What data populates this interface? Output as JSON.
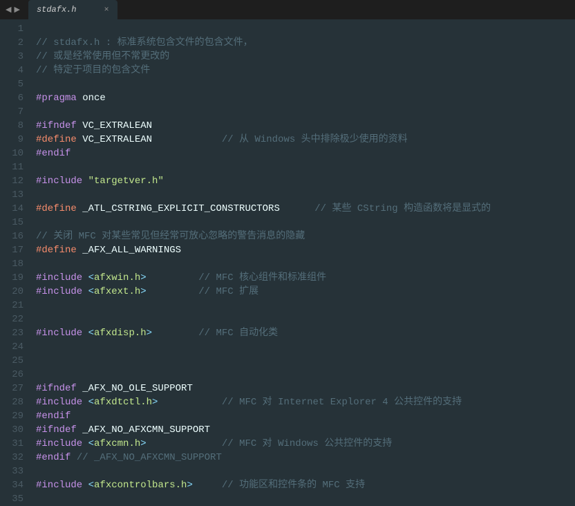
{
  "tab": {
    "title": "stdafx.h",
    "close": "×"
  },
  "nav": {
    "left": "◀",
    "right": "▶"
  },
  "code_lines": [
    {
      "n": 1,
      "tokens": []
    },
    {
      "n": 2,
      "tokens": [
        {
          "cls": "c-comment",
          "t": "// stdafx.h : 标准系统包含文件的包含文件，"
        }
      ]
    },
    {
      "n": 3,
      "tokens": [
        {
          "cls": "c-comment",
          "t": "// 或是经常使用但不常更改的"
        }
      ]
    },
    {
      "n": 4,
      "tokens": [
        {
          "cls": "c-comment",
          "t": "// 特定于项目的包含文件"
        }
      ]
    },
    {
      "n": 5,
      "tokens": []
    },
    {
      "n": 6,
      "tokens": [
        {
          "cls": "c-preproc",
          "t": "#pragma"
        },
        {
          "cls": "c-plain",
          "t": " once"
        }
      ]
    },
    {
      "n": 7,
      "tokens": []
    },
    {
      "n": 8,
      "tokens": [
        {
          "cls": "c-preproc",
          "t": "#ifndef"
        },
        {
          "cls": "c-plain",
          "t": " VC_EXTRALEAN"
        }
      ]
    },
    {
      "n": 9,
      "tokens": [
        {
          "cls": "c-define",
          "t": "#define"
        },
        {
          "cls": "c-plain",
          "t": " VC_EXTRALEAN            "
        },
        {
          "cls": "c-comment",
          "t": "// 从 Windows 头中排除极少使用的资料"
        }
      ]
    },
    {
      "n": 10,
      "tokens": [
        {
          "cls": "c-preproc",
          "t": "#endif"
        }
      ]
    },
    {
      "n": 11,
      "tokens": []
    },
    {
      "n": 12,
      "tokens": [
        {
          "cls": "c-preproc",
          "t": "#include "
        },
        {
          "cls": "c-string",
          "t": "\"targetver.h\""
        }
      ]
    },
    {
      "n": 13,
      "tokens": []
    },
    {
      "n": 14,
      "tokens": [
        {
          "cls": "c-define",
          "t": "#define"
        },
        {
          "cls": "c-plain",
          "t": " _ATL_CSTRING_EXPLICIT_CONSTRUCTORS      "
        },
        {
          "cls": "c-comment",
          "t": "// 某些 CString 构造函数将是显式的"
        }
      ]
    },
    {
      "n": 15,
      "tokens": []
    },
    {
      "n": 16,
      "tokens": [
        {
          "cls": "c-comment",
          "t": "// 关闭 MFC 对某些常见但经常可放心忽略的警告消息的隐藏"
        }
      ]
    },
    {
      "n": 17,
      "tokens": [
        {
          "cls": "c-define",
          "t": "#define"
        },
        {
          "cls": "c-plain",
          "t": " _AFX_ALL_WARNINGS"
        }
      ]
    },
    {
      "n": 18,
      "tokens": []
    },
    {
      "n": 19,
      "tokens": [
        {
          "cls": "c-preproc",
          "t": "#include "
        },
        {
          "cls": "c-include-angle",
          "t": "<"
        },
        {
          "cls": "c-include-name",
          "t": "afxwin.h"
        },
        {
          "cls": "c-include-angle",
          "t": ">"
        },
        {
          "cls": "c-plain",
          "t": "         "
        },
        {
          "cls": "c-comment",
          "t": "// MFC 核心组件和标准组件"
        }
      ]
    },
    {
      "n": 20,
      "tokens": [
        {
          "cls": "c-preproc",
          "t": "#include "
        },
        {
          "cls": "c-include-angle",
          "t": "<"
        },
        {
          "cls": "c-include-name",
          "t": "afxext.h"
        },
        {
          "cls": "c-include-angle",
          "t": ">"
        },
        {
          "cls": "c-plain",
          "t": "         "
        },
        {
          "cls": "c-comment",
          "t": "// MFC 扩展"
        }
      ]
    },
    {
      "n": 21,
      "tokens": []
    },
    {
      "n": 22,
      "tokens": []
    },
    {
      "n": 23,
      "tokens": [
        {
          "cls": "c-preproc",
          "t": "#include "
        },
        {
          "cls": "c-include-angle",
          "t": "<"
        },
        {
          "cls": "c-include-name",
          "t": "afxdisp.h"
        },
        {
          "cls": "c-include-angle",
          "t": ">"
        },
        {
          "cls": "c-plain",
          "t": "        "
        },
        {
          "cls": "c-comment",
          "t": "// MFC 自动化类"
        }
      ]
    },
    {
      "n": 24,
      "tokens": []
    },
    {
      "n": 25,
      "tokens": []
    },
    {
      "n": 26,
      "tokens": []
    },
    {
      "n": 27,
      "tokens": [
        {
          "cls": "c-preproc",
          "t": "#ifndef"
        },
        {
          "cls": "c-plain",
          "t": " _AFX_NO_OLE_SUPPORT"
        }
      ]
    },
    {
      "n": 28,
      "tokens": [
        {
          "cls": "c-preproc",
          "t": "#include "
        },
        {
          "cls": "c-include-angle",
          "t": "<"
        },
        {
          "cls": "c-include-name",
          "t": "afxdtctl.h"
        },
        {
          "cls": "c-include-angle",
          "t": ">"
        },
        {
          "cls": "c-plain",
          "t": "           "
        },
        {
          "cls": "c-comment",
          "t": "// MFC 对 Internet Explorer 4 公共控件的支持"
        }
      ]
    },
    {
      "n": 29,
      "tokens": [
        {
          "cls": "c-preproc",
          "t": "#endif"
        }
      ]
    },
    {
      "n": 30,
      "tokens": [
        {
          "cls": "c-preproc",
          "t": "#ifndef"
        },
        {
          "cls": "c-plain",
          "t": " _AFX_NO_AFXCMN_SUPPORT"
        }
      ]
    },
    {
      "n": 31,
      "tokens": [
        {
          "cls": "c-preproc",
          "t": "#include "
        },
        {
          "cls": "c-include-angle",
          "t": "<"
        },
        {
          "cls": "c-include-name",
          "t": "afxcmn.h"
        },
        {
          "cls": "c-include-angle",
          "t": ">"
        },
        {
          "cls": "c-plain",
          "t": "             "
        },
        {
          "cls": "c-comment",
          "t": "// MFC 对 Windows 公共控件的支持"
        }
      ]
    },
    {
      "n": 32,
      "tokens": [
        {
          "cls": "c-preproc",
          "t": "#endif"
        },
        {
          "cls": "c-plain",
          "t": " "
        },
        {
          "cls": "c-comment",
          "t": "// _AFX_NO_AFXCMN_SUPPORT"
        }
      ]
    },
    {
      "n": 33,
      "tokens": []
    },
    {
      "n": 34,
      "tokens": [
        {
          "cls": "c-preproc",
          "t": "#include "
        },
        {
          "cls": "c-include-angle",
          "t": "<"
        },
        {
          "cls": "c-include-name",
          "t": "afxcontrolbars.h"
        },
        {
          "cls": "c-include-angle",
          "t": ">"
        },
        {
          "cls": "c-plain",
          "t": "     "
        },
        {
          "cls": "c-comment",
          "t": "// 功能区和控件条的 MFC 支持"
        }
      ]
    },
    {
      "n": 35,
      "tokens": []
    }
  ]
}
